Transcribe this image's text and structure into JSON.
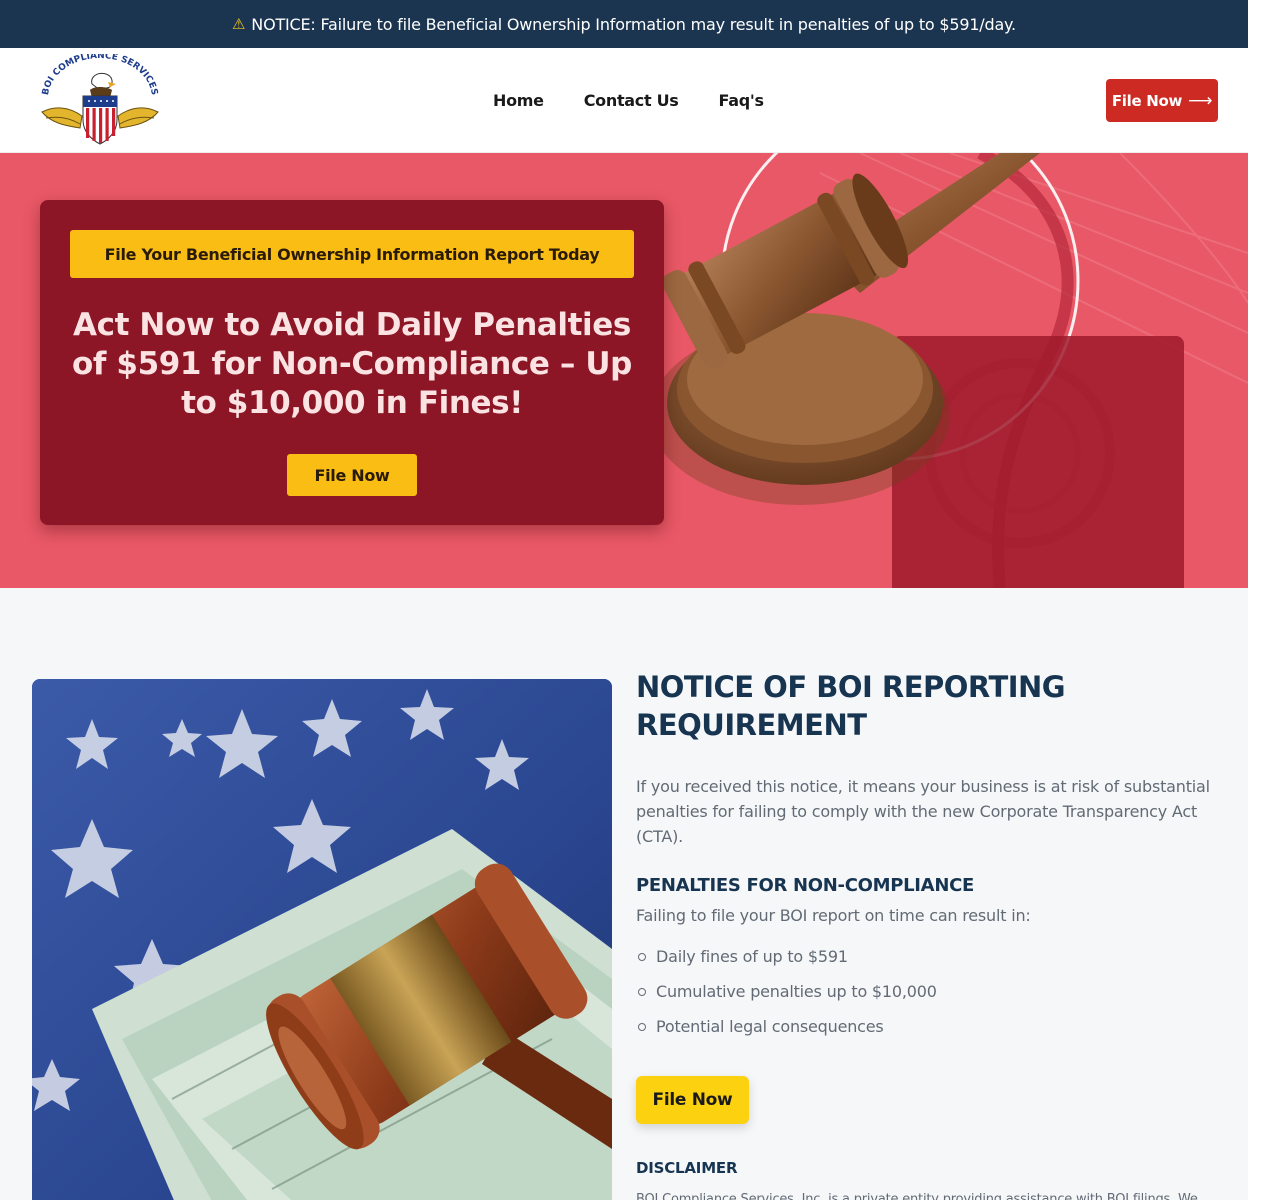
{
  "notice_bar": {
    "icon": "warning-icon",
    "text": "NOTICE: Failure to file Beneficial Ownership Information may result in penalties of up to $591/day."
  },
  "header": {
    "logo": {
      "text": "BOI COMPLIANCE SERVICES",
      "icon": "eagle-shield-logo"
    },
    "nav": [
      {
        "label": "Home"
      },
      {
        "label": "Contact Us"
      },
      {
        "label": "Faq's"
      }
    ],
    "cta": {
      "label": "File Now",
      "icon": "arrow-right-icon"
    }
  },
  "hero": {
    "pill": "File Your Beneficial Ownership Information Report Today",
    "title": "Act Now to Avoid Daily Penalties of $591 for Non-Compliance – Up to $10,000 in Fines!",
    "button": "File Now"
  },
  "main": {
    "title": "NOTICE OF BOI REPORTING REQUIREMENT",
    "intro": "If you received this notice, it means your business is at risk of substantial penalties for failing to comply with the new Corporate Transparency Act (CTA).",
    "penalties_title": "PENALTIES FOR NON-COMPLIANCE",
    "penalties_lead": "Failing to file your BOI report on time can result in:",
    "penalties": [
      "Daily fines of up to $591",
      "Cumulative penalties up to $10,000",
      "Potential legal consequences"
    ],
    "button": "File Now",
    "disclaimer_title": "DISCLAIMER",
    "disclaimer_text": "BOI Compliance Services, Inc. is a private entity providing assistance with BOI filings. We"
  },
  "colors": {
    "navy": "#1b3550",
    "red_button": "#cc2a23",
    "hero_bg": "#e95866",
    "hero_card": "#8c1625",
    "yellow": "#f9bd14",
    "main_button": "#fcd10f"
  }
}
